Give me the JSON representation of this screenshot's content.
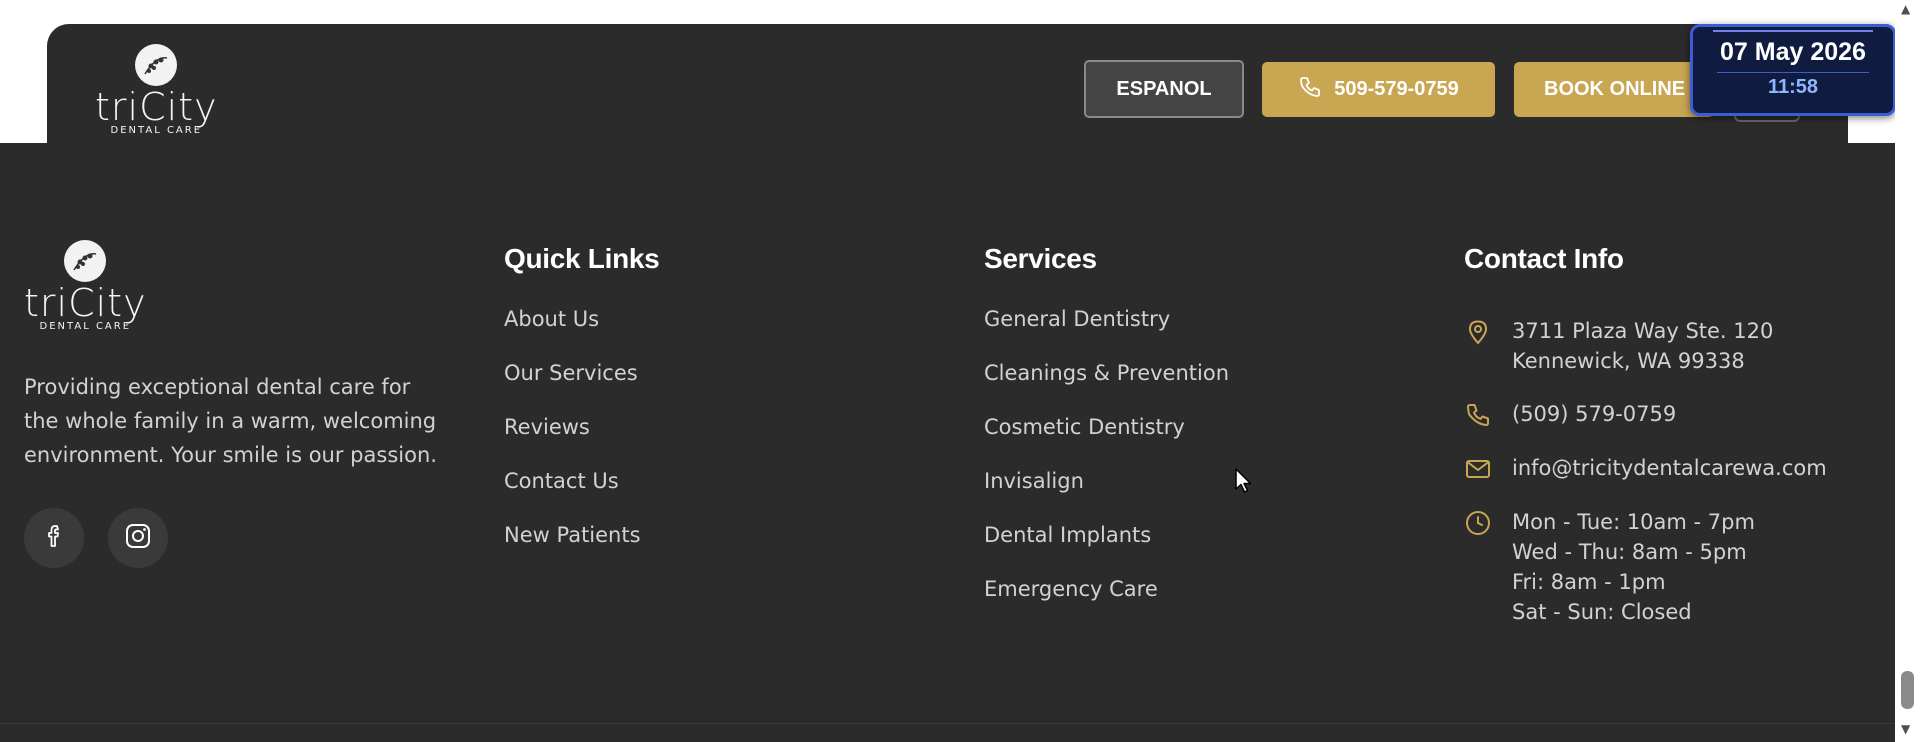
{
  "header": {
    "logo": {
      "word": "triCity",
      "sub": "DENTAL CARE"
    },
    "espanol_label": "ESPANOL",
    "phone_label": "509-579-0759",
    "book_label": "BOOK ONLINE"
  },
  "clock": {
    "date": "07 May 2026",
    "time": "11:58"
  },
  "footer": {
    "logo": {
      "word": "triCity",
      "sub": "DENTAL CARE"
    },
    "about_text": "Providing exceptional dental care for the whole family in a warm, welcoming environment. Your smile is our passion.",
    "social": [
      {
        "icon": "facebook-icon"
      },
      {
        "icon": "instagram-icon"
      }
    ],
    "quick_links": {
      "title": "Quick Links",
      "items": [
        "About Us",
        "Our Services",
        "Reviews",
        "Contact Us",
        "New Patients"
      ]
    },
    "services": {
      "title": "Services",
      "items": [
        "General Dentistry",
        "Cleanings & Prevention",
        "Cosmetic Dentistry",
        "Invisalign",
        "Dental Implants",
        "Emergency Care"
      ]
    },
    "contact": {
      "title": "Contact Info",
      "address_line1": "3711 Plaza Way Ste. 120",
      "address_line2": "Kennewick, WA 99338",
      "phone": "(509) 579-0759",
      "email": "info@tricitydentalcarewa.com",
      "hours": [
        "Mon - Tue: 10am - 7pm",
        "Wed - Thu: 8am - 5pm",
        "Fri: 8am - 1pm",
        "Sat - Sun: Closed"
      ]
    }
  },
  "colors": {
    "accent": "#c8a652",
    "background": "#2b2b2b",
    "clock_bg": "#0f1b3f"
  }
}
